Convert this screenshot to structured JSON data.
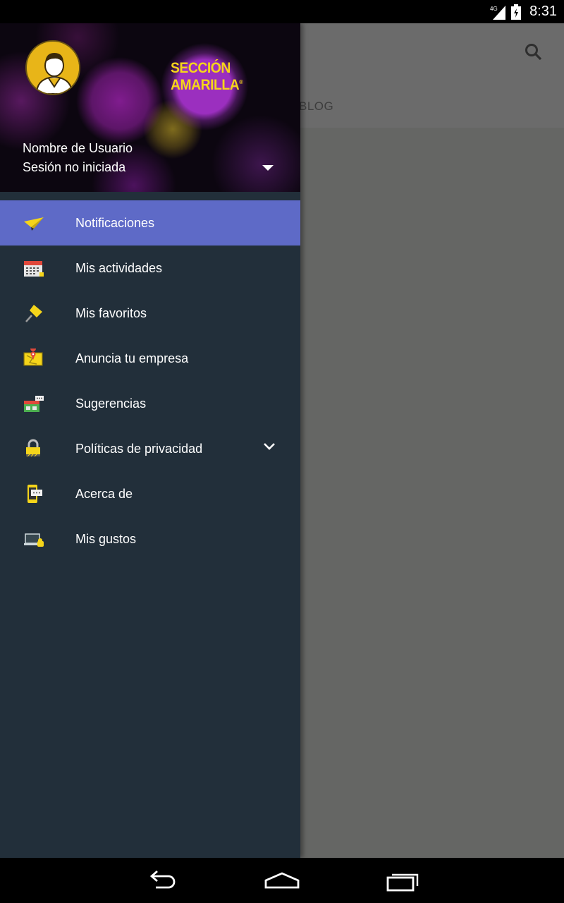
{
  "status_bar": {
    "network": "4G",
    "time": "8:31"
  },
  "background_app": {
    "tab_label": "BLOG"
  },
  "drawer": {
    "brand": "SECCIÓN AMARILLA",
    "user_name": "Nombre de Usuario",
    "user_status": "Sesión no iniciada",
    "menu": [
      {
        "label": "Notificaciones",
        "icon": "paper-plane-icon",
        "active": true
      },
      {
        "label": "Mis actividades",
        "icon": "calendar-icon"
      },
      {
        "label": "Mis favoritos",
        "icon": "pin-icon"
      },
      {
        "label": "Anuncia tu empresa",
        "icon": "map-icon"
      },
      {
        "label": "Sugerencias",
        "icon": "store-icon"
      },
      {
        "label": "Políticas de privacidad",
        "icon": "lock-icon",
        "expandable": true
      },
      {
        "label": "Acerca de",
        "icon": "phone-chat-icon"
      },
      {
        "label": "Mis gustos",
        "icon": "laptop-icon"
      }
    ]
  },
  "colors": {
    "accent": "#5e6ac7",
    "drawer_bg": "#222f3a",
    "brand_yellow": "#f5d51a"
  }
}
